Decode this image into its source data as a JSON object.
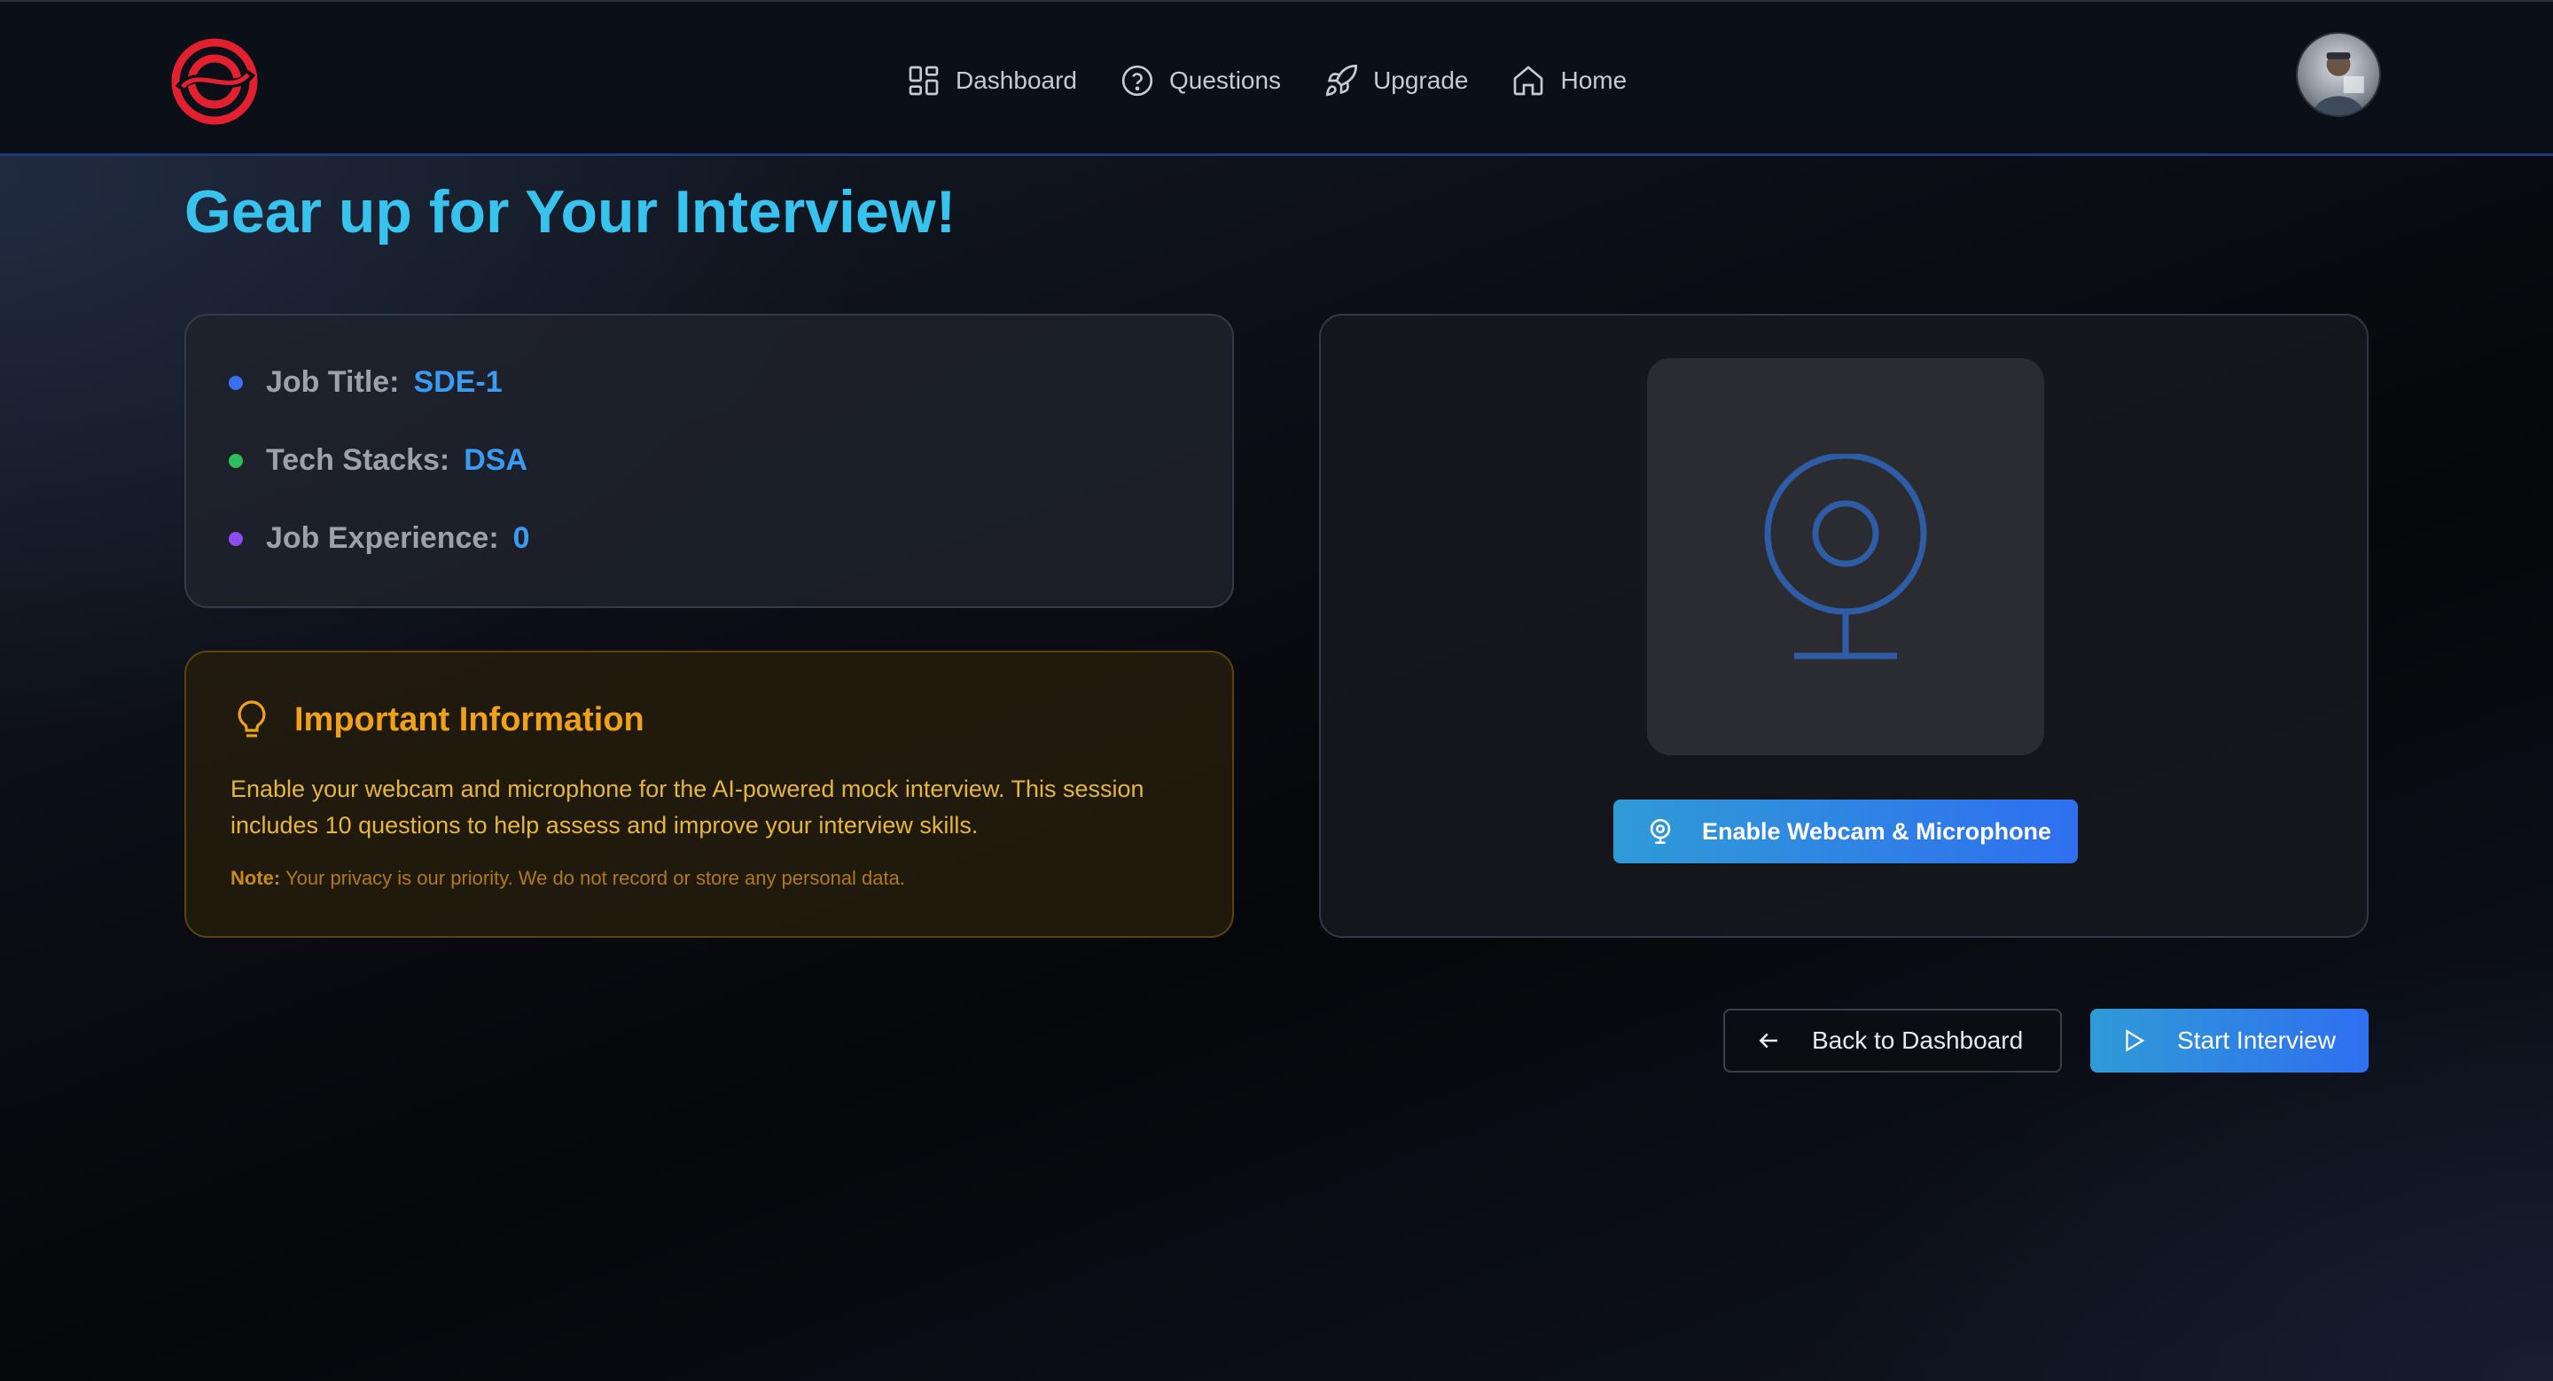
{
  "header": {
    "logo_icon": "brand-logo-icon",
    "nav": [
      {
        "label": "Dashboard",
        "icon": "dashboard-grid-icon"
      },
      {
        "label": "Questions",
        "icon": "question-circle-icon"
      },
      {
        "label": "Upgrade",
        "icon": "rocket-icon"
      },
      {
        "label": "Home",
        "icon": "home-icon"
      }
    ],
    "avatar_icon": "user-avatar"
  },
  "page": {
    "title": "Gear up for Your Interview!"
  },
  "details": {
    "job_title_label": "Job Title:",
    "job_title_value": "SDE-1",
    "tech_stacks_label": "Tech Stacks:",
    "tech_stacks_value": "DSA",
    "experience_label": "Job Experience:",
    "experience_value": "0",
    "dot_colors": [
      "#3b6ef0",
      "#2fbf5a",
      "#8c4cf0"
    ]
  },
  "important": {
    "icon": "lightbulb-icon",
    "title": "Important Information",
    "body": "Enable your webcam and microphone for the AI-powered mock interview. This session includes 10 questions to help assess and improve your interview skills.",
    "note_label": "Note:",
    "note_text": "Your privacy is our priority. We do not record or store any personal data."
  },
  "webcam": {
    "placeholder_icon": "webcam-icon",
    "enable_button_label": "Enable Webcam & Microphone"
  },
  "actions": {
    "back_label": "Back to Dashboard",
    "start_label": "Start Interview"
  },
  "colors": {
    "title": "#38c3ef",
    "accent_blue": "#2f6ff0",
    "warning": "#f0a11a",
    "brand_red": "#e3202f"
  }
}
